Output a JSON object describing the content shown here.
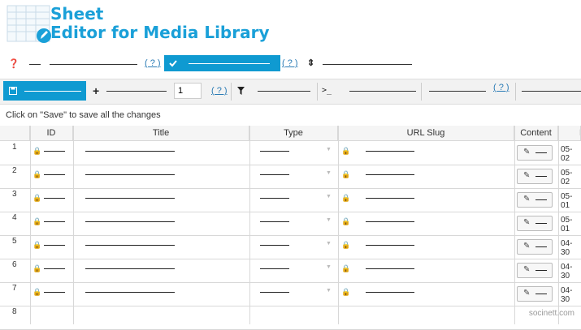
{
  "app": {
    "title_line1": "Sheet",
    "title_line2": "Editor for Media Library",
    "brand_color": "#1aa0d8",
    "accent_color": "#0f9ad1"
  },
  "top_row": {
    "help_label": "( ? )",
    "help_label_2": "( ? )",
    "check_icon": "checkmark-icon",
    "question_icon": "question-circle-icon",
    "sort_icon": "sort-arrows-icon"
  },
  "toolbar": {
    "save_icon": "floppy-disk-icon",
    "plus_icon": "plus-icon",
    "rows_value": "1",
    "help_label": "( ? )",
    "filter_icon": "filter-icon",
    "terminal_icon": "terminal-icon",
    "terminal_label": ">_",
    "help_label_2": "( ? )"
  },
  "hint": "Click on \"Save\" to save all the changes",
  "table": {
    "columns": [
      "ID",
      "Title",
      "Type",
      "URL Slug",
      "Content",
      "D"
    ],
    "rows": [
      {
        "num": "1",
        "date": "05-02"
      },
      {
        "num": "2",
        "date": "05-02"
      },
      {
        "num": "3",
        "date": "05-01"
      },
      {
        "num": "4",
        "date": "05-01"
      },
      {
        "num": "5",
        "date": "04-30"
      },
      {
        "num": "6",
        "date": "04-30"
      },
      {
        "num": "7",
        "date": "04-30"
      },
      {
        "num": "8",
        "date": ""
      }
    ]
  },
  "watermark": "socinett.com"
}
